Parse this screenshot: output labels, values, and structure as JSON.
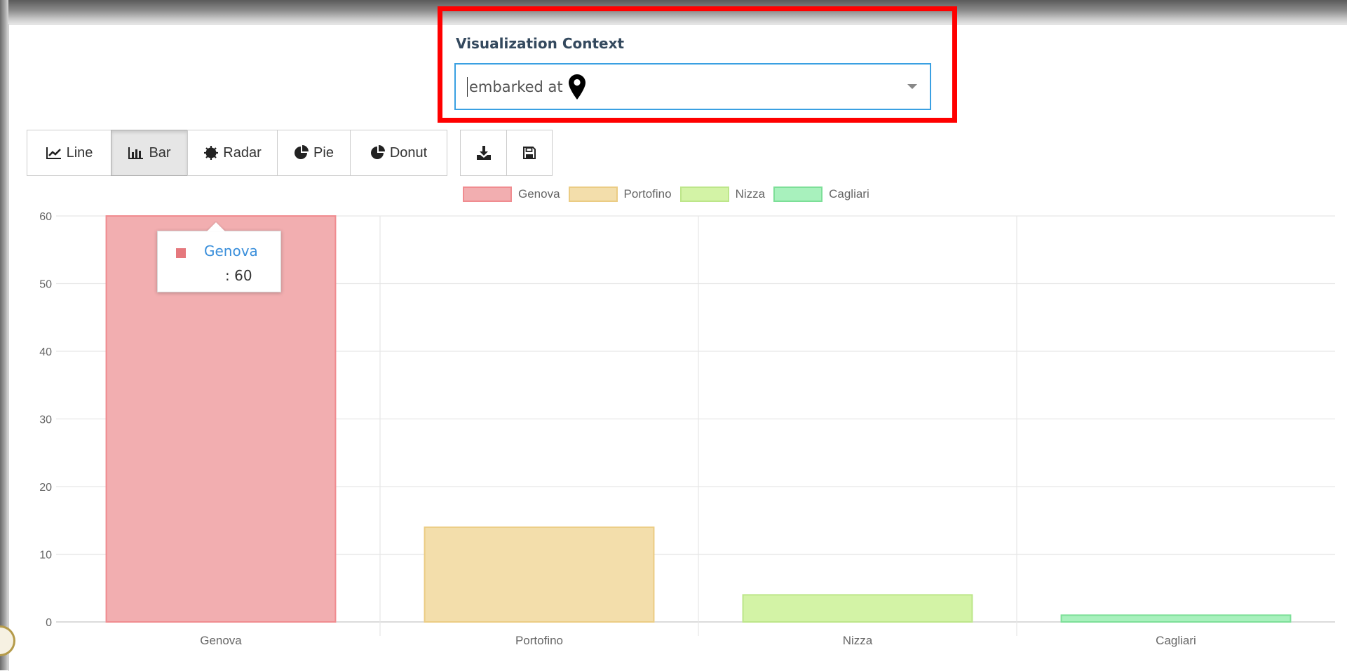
{
  "context": {
    "label": "Visualization Context",
    "selected_value": "embarked at",
    "selected_icon": "map-marker-icon"
  },
  "chart_types": [
    {
      "label": "Line",
      "icon": "line-chart-icon",
      "active": false
    },
    {
      "label": "Bar",
      "icon": "bar-chart-icon",
      "active": true
    },
    {
      "label": "Radar",
      "icon": "radar-icon",
      "active": false
    },
    {
      "label": "Pie",
      "icon": "pie-chart-icon",
      "active": false
    },
    {
      "label": "Donut",
      "icon": "donut-chart-icon",
      "active": false
    }
  ],
  "actions": [
    {
      "icon": "download-icon"
    },
    {
      "icon": "save-icon"
    }
  ],
  "tooltip": {
    "name": "Genova",
    "value": ": 60",
    "color": "#e5787d"
  },
  "chart_data": {
    "type": "bar",
    "categories": [
      "Genova",
      "Portofino",
      "Nizza",
      "Cagliari"
    ],
    "values": [
      60,
      14,
      4,
      1
    ],
    "legend": [
      {
        "name": "Genova",
        "fill": "#f2aeb0",
        "stroke": "#f08c90"
      },
      {
        "name": "Portofino",
        "fill": "#f3deab",
        "stroke": "#ebcc84"
      },
      {
        "name": "Nizza",
        "fill": "#d3f3a6",
        "stroke": "#bde68a"
      },
      {
        "name": "Cagliari",
        "fill": "#a8f1bd",
        "stroke": "#7ddf98"
      }
    ],
    "ylim": [
      0,
      60
    ],
    "yticks": [
      0,
      10,
      20,
      30,
      40,
      50,
      60
    ],
    "legend_position": "top-center",
    "grid": true
  }
}
